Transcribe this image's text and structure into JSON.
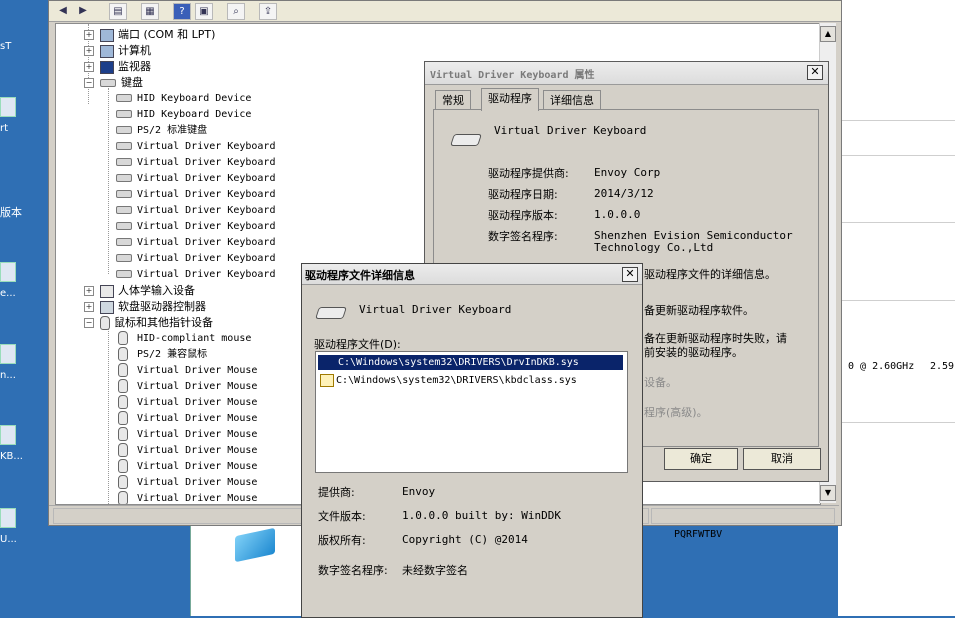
{
  "desktop": {
    "labels": [
      "sT",
      "rt",
      "版本",
      "e...",
      "n...",
      "KB...",
      "U..."
    ]
  },
  "bg_window": {
    "cpu_text": "0 @ 2.60GHz",
    "cpu_speed": "2.59",
    "product_key": "PQRFWTBV"
  },
  "device_manager": {
    "categories": {
      "ports": "端口 (COM 和 LPT)",
      "computer": "计算机",
      "monitor": "监视器",
      "keyboard": "键盘",
      "hid": "人体学输入设备",
      "floppy": "软盘驱动器控制器",
      "mouse": "鼠标和其他指针设备"
    },
    "keyboards": [
      "HID Keyboard Device",
      "HID Keyboard Device",
      "PS/2 标准键盘",
      "Virtual Driver Keyboard",
      "Virtual Driver Keyboard",
      "Virtual Driver Keyboard",
      "Virtual Driver Keyboard",
      "Virtual Driver Keyboard",
      "Virtual Driver Keyboard",
      "Virtual Driver Keyboard",
      "Virtual Driver Keyboard",
      "Virtual Driver Keyboard"
    ],
    "mice": [
      "HID-compliant mouse",
      "PS/2 兼容鼠标",
      "Virtual Driver Mouse",
      "Virtual Driver Mouse",
      "Virtual Driver Mouse",
      "Virtual Driver Mouse",
      "Virtual Driver Mouse",
      "Virtual Driver Mouse",
      "Virtual Driver Mouse",
      "Virtual Driver Mouse",
      "Virtual Driver Mouse"
    ]
  },
  "props_dialog": {
    "title": "Virtual Driver Keyboard 属性",
    "tabs": [
      "常规",
      "驱动程序",
      "详细信息"
    ],
    "device_name": "Virtual Driver Keyboard",
    "provider_label": "驱动程序提供商:",
    "provider_value": "Envoy Corp",
    "date_label": "驱动程序日期:",
    "date_value": "2014/3/12",
    "version_label": "驱动程序版本:",
    "version_value": "1.0.0.0",
    "signer_label": "数字签名程序:",
    "signer_value_1": "Shenzhen Evision Semiconductor",
    "signer_value_2": "Technology Co.,Ltd",
    "desc_details": "驱动程序文件的详细信息。",
    "desc_update": "备更新驱动程序软件。",
    "desc_rollback_1": "备在更新驱动程序时失败，请",
    "desc_rollback_2": "前安装的驱动程序。",
    "desc_disable": "设备。",
    "desc_uninstall": "程序(高级)。",
    "ok": "确定",
    "cancel": "取消"
  },
  "details_dialog": {
    "title": "驱动程序文件详细信息",
    "device_name": "Virtual Driver Keyboard",
    "files_label": "驱动程序文件(D):",
    "files": [
      "C:\\Windows\\system32\\DRIVERS\\DrvInDKB.sys",
      "C:\\Windows\\system32\\DRIVERS\\kbdclass.sys"
    ],
    "provider_label": "提供商:",
    "provider_value": "Envoy",
    "version_label": "文件版本:",
    "version_value": "1.0.0.0 built by: WinDDK",
    "copyright_label": "版权所有:",
    "copyright_value": "Copyright (C) @2014",
    "signer_label": "数字签名程序:",
    "signer_value": "未经数字签名"
  }
}
